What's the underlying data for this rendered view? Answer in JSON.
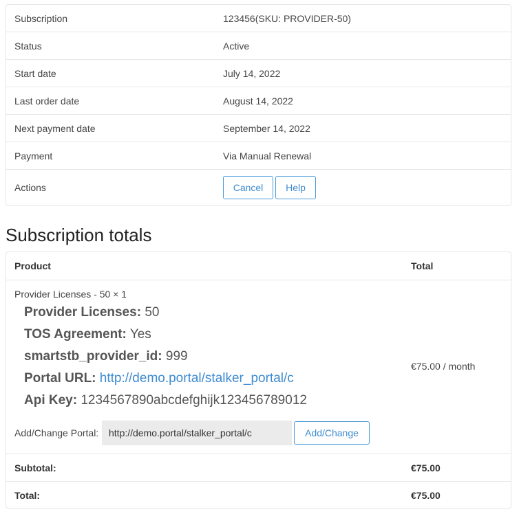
{
  "subscription_info": {
    "rows": [
      {
        "label": "Subscription",
        "value": "123456(SKU: PROVIDER-50)"
      },
      {
        "label": "Status",
        "value": "Active"
      },
      {
        "label": "Start date",
        "value": "July 14, 2022"
      },
      {
        "label": "Last order date",
        "value": "August 14, 2022"
      },
      {
        "label": "Next payment date",
        "value": "September 14, 2022"
      },
      {
        "label": "Payment",
        "value": "Via Manual Renewal"
      }
    ],
    "actions_label": "Actions",
    "cancel_label": "Cancel",
    "help_label": "Help"
  },
  "totals": {
    "title": "Subscription totals",
    "col_product": "Product",
    "col_total": "Total",
    "item": {
      "name": "Provider Licenses - 50 × 1",
      "meta": [
        {
          "key": "Provider Licenses:",
          "value": "50"
        },
        {
          "key": "TOS Agreement:",
          "value": "Yes"
        },
        {
          "key": "smartstb_provider_id:",
          "value": "999"
        },
        {
          "key": "Portal URL:",
          "value": "http://demo.portal/stalker_portal/c"
        },
        {
          "key": "Api Key:",
          "value": "1234567890abcdefghijk123456789012"
        }
      ],
      "total": "€75.00 / month",
      "portal_label": "Add/Change Portal:",
      "portal_value": "http://demo.portal/stalker_portal/c",
      "portal_button": "Add/Change"
    },
    "subtotal_label": "Subtotal:",
    "subtotal_value": "€75.00",
    "total_label": "Total:",
    "total_value": "€75.00"
  },
  "colors": {
    "accent": "#3d8bd0",
    "border": "#e6e6e6",
    "input_bg": "#ebebeb"
  }
}
